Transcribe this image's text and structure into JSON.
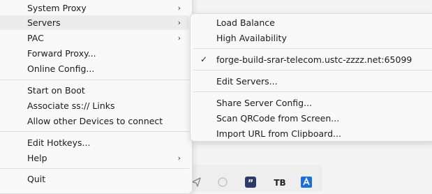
{
  "main_menu": {
    "items": [
      {
        "label": "System Proxy",
        "has_submenu": true
      },
      {
        "label": "Servers",
        "has_submenu": true,
        "highlighted": true
      },
      {
        "label": "PAC",
        "has_submenu": true
      },
      {
        "label": "Forward Proxy..."
      },
      {
        "label": "Online Config..."
      },
      {
        "label": "Start on Boot"
      },
      {
        "label": "Associate ss:// Links"
      },
      {
        "label": "Allow other Devices to connect"
      },
      {
        "label": "Edit Hotkeys..."
      },
      {
        "label": "Help",
        "has_submenu": true
      },
      {
        "label": "Quit"
      }
    ]
  },
  "servers_submenu": {
    "items": [
      {
        "label": "Load Balance"
      },
      {
        "label": "High Availability"
      },
      {
        "label": "forge-build-srar-telecom.ustc-zzzz.net:65099",
        "checked": true
      },
      {
        "label": "Edit Servers..."
      },
      {
        "label": "Share Server Config..."
      },
      {
        "label": "Scan QRCode from Screen..."
      },
      {
        "label": "Import URL from Clipboard..."
      }
    ]
  },
  "glyphs": {
    "chevron": "›",
    "check": "✓"
  },
  "taskbar": {
    "icons": [
      "send-icon",
      "circle-app-icon",
      "quote-app-icon",
      "tb-app-icon",
      "blue-app-icon"
    ],
    "quote_label": "”",
    "tb_label": "TB"
  },
  "colors": {
    "menu_background": "#f9f9f9",
    "highlight": "#ececec",
    "separator": "#dedede",
    "tray_blue": "#1e6fd9",
    "quote_icon": "#2b3a67"
  }
}
